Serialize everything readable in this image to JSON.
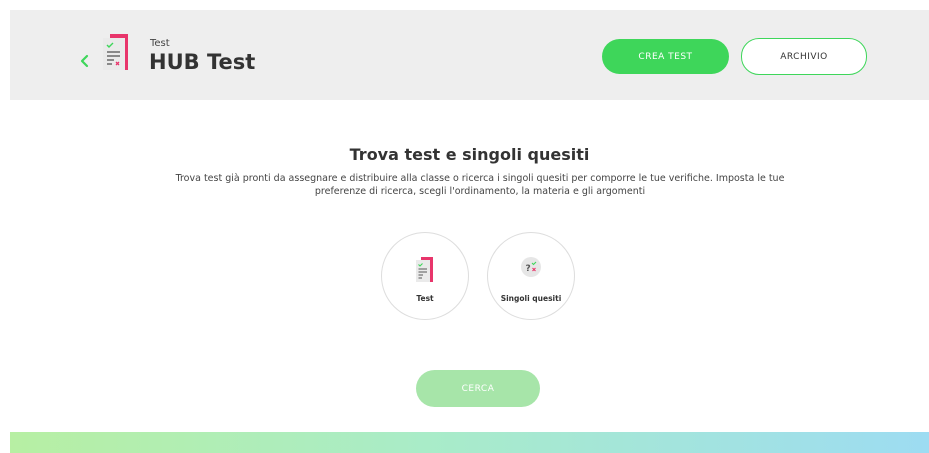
{
  "header": {
    "subtitle": "Test",
    "title": "HUB Test",
    "crea_label": "CREA TEST",
    "archivio_label": "ARCHIVIO"
  },
  "main": {
    "title": "Trova test e singoli quesiti",
    "description": "Trova test già pronti da assegnare e distribuire alla classe o ricerca i singoli quesiti per comporre le tue verifiche. Imposta le tue preferenze di ricerca, scegli l'ordinamento, la materia e gli argomenti",
    "options": [
      {
        "label": "Test",
        "icon": "test-document-icon"
      },
      {
        "label": "Singoli quesiti",
        "icon": "question-icon"
      }
    ],
    "search_label": "CERCA"
  },
  "colors": {
    "accent": "#3ed65a",
    "accent_disabled": "#a7e5a9",
    "brand_pink": "#e8356b",
    "header_bg": "#eeeeee"
  }
}
